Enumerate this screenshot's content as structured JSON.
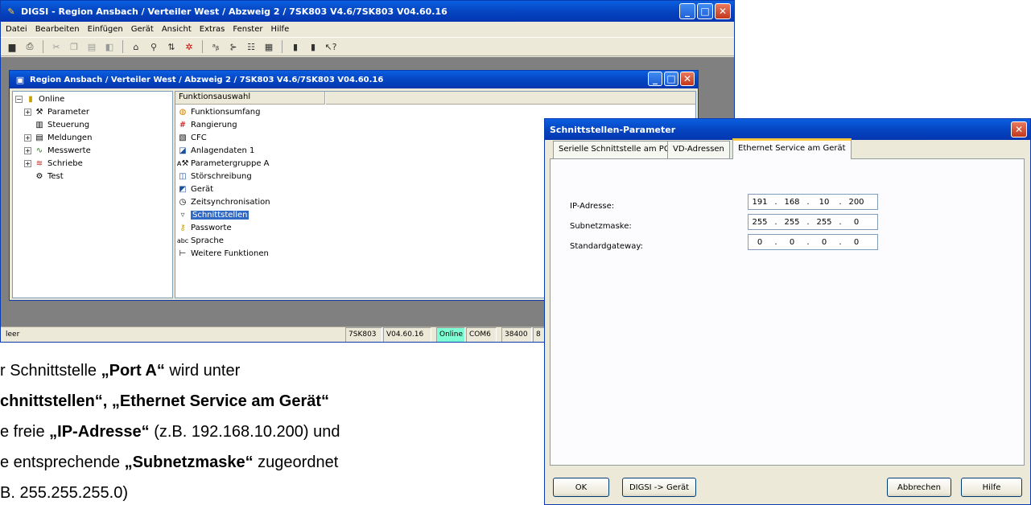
{
  "main_window": {
    "title": "DIGSI - Region Ansbach / Verteiler West / Abzweig 2 / 7SK803 V4.6/7SK803 V04.60.16",
    "menu": [
      "Datei",
      "Bearbeiten",
      "Einfügen",
      "Gerät",
      "Ansicht",
      "Extras",
      "Fenster",
      "Hilfe"
    ],
    "toolbar_icons": [
      "save-icon",
      "print-icon",
      "cut-icon",
      "copy-icon",
      "paste-icon",
      "properties-icon",
      "tool-icon",
      "tool-icon",
      "tool-icon",
      "tool-icon",
      "tool-icon",
      "tool-icon",
      "tool-icon",
      "tool-icon",
      "tool-icon",
      "context-help-icon"
    ],
    "status_left": "leer",
    "status_cells": [
      "7SK803",
      "V04.60.16",
      "Online",
      "COM6",
      "38400",
      "8"
    ]
  },
  "inner_window": {
    "title": "Region Ansbach / Verteiler West / Abzweig 2 / 7SK803 V4.6/7SK803 V04.60.16",
    "tree": {
      "root": "Online",
      "items": [
        {
          "label": "Parameter",
          "icon": "parameter-icon",
          "expandable": true
        },
        {
          "label": "Steuerung",
          "icon": "control-icon",
          "expandable": false
        },
        {
          "label": "Meldungen",
          "icon": "messages-icon",
          "expandable": true
        },
        {
          "label": "Messwerte",
          "icon": "measurement-icon",
          "expandable": true
        },
        {
          "label": "Schriebe",
          "icon": "records-icon",
          "expandable": true
        },
        {
          "label": "Test",
          "icon": "test-icon",
          "expandable": false
        }
      ]
    },
    "list_header": "Funktionsauswahl",
    "functions": [
      "Funktionsumfang",
      "Rangierung",
      "CFC",
      "Anlagendaten 1",
      "Parametergruppe A",
      "Störschreibung",
      "Gerät",
      "Zeitsynchronisation",
      "Schnittstellen",
      "Passworte",
      "Sprache",
      "Weitere Funktionen"
    ],
    "selected_function": "Schnittstellen"
  },
  "dialog": {
    "title": "Schnittstellen-Parameter",
    "tabs": [
      "Serielle Schnittstelle am PC",
      "VD-Adressen",
      "Ethernet Service am Gerät"
    ],
    "active_tab": "Ethernet Service am Gerät",
    "fields": [
      {
        "label": "IP-Adresse:",
        "octets": [
          "191",
          "168",
          "10",
          "200"
        ]
      },
      {
        "label": "Subnetzmaske:",
        "octets": [
          "255",
          "255",
          "255",
          "0"
        ]
      },
      {
        "label": "Standardgateway:",
        "octets": [
          "0",
          "0",
          "0",
          "0"
        ]
      }
    ],
    "buttons": {
      "ok": "OK",
      "digsi": "DIGSI -> Gerät",
      "cancel": "Abbrechen",
      "help": "Hilfe"
    }
  },
  "body_text": {
    "line1": {
      "a": "r Schnittstelle ",
      "b": "„Port A“",
      "c": " wird unter"
    },
    "line2": {
      "a": "chnittstellen“, „Ethernet Service am Gerät“"
    },
    "line3": {
      "a": "e freie ",
      "b": "„IP-Adresse“",
      "c": " (z.B. 192.168.10.200) und"
    },
    "line4": {
      "a": "e entsprechende ",
      "b": "„Subnetzmaske“",
      "c": " zugeordnet"
    },
    "line5": {
      "a": "B. 255.255.255.0)"
    }
  }
}
